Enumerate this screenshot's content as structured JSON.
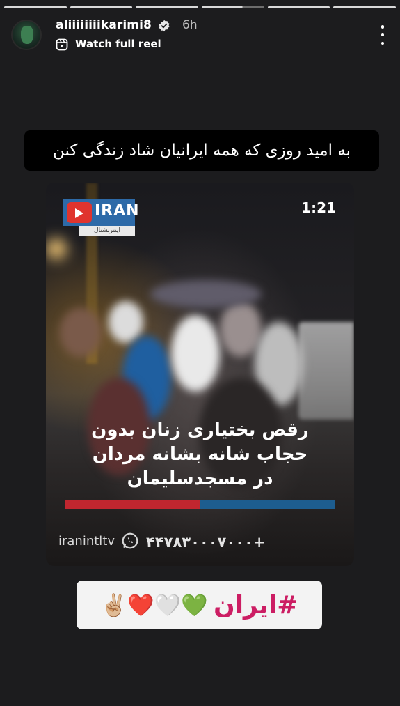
{
  "story": {
    "username": "aliiiiiiiikarimi8",
    "time_ago": "6h",
    "reel_label": "Watch full reel"
  },
  "caption": "به امید روزی که همه ایرانیان شاد زندگی کنن",
  "video": {
    "channel": "IRAN",
    "channel_sub": "اینترنشنال",
    "duration": "1:21",
    "headline": [
      "رقص بختیاری زنان بدون",
      "حجاب شانه بشانه مردان",
      "در مسجدسلیمان"
    ],
    "handle": "iranintltv",
    "phone": "+۴۴۷۸۳۰۰۰۷۰۰۰"
  },
  "sticker": {
    "hashtag": "#ایران",
    "emojis": "💚🤍❤️✌🏼"
  },
  "colors": {
    "background": "#1c1c1e",
    "hashtag": "#cc1d63",
    "logo_blue": "#2d6aa8",
    "logo_red": "#e0342e"
  },
  "icons": [
    "verified-badge-icon",
    "reel-icon",
    "more-options-icon",
    "whatsapp-icon"
  ]
}
